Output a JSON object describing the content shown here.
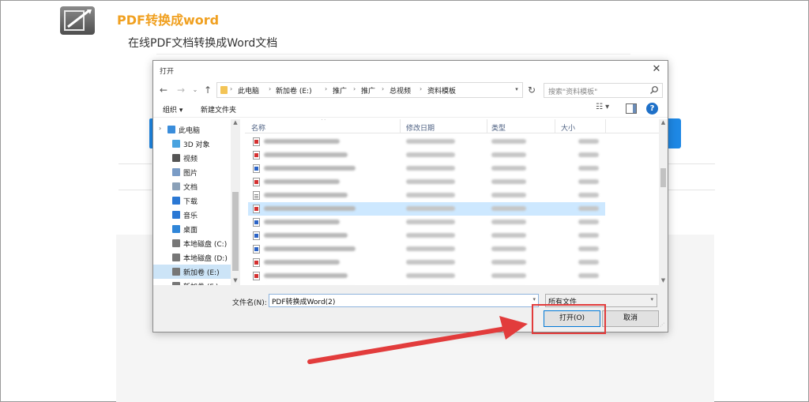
{
  "page": {
    "title": "PDF转换成word",
    "subtitle": "在线PDF文档转换成Word文档"
  },
  "dialog": {
    "title": "打开",
    "close_glyph": "✕",
    "nav": {
      "back": "←",
      "forward": "→",
      "recent": "⌄",
      "up": "↑",
      "refresh": "↻"
    },
    "breadcrumbs": [
      "此电脑",
      "新加卷 (E:)",
      "推广",
      "推广",
      "总视频",
      "资料模板"
    ],
    "crumb_separator": "›",
    "search_placeholder": "搜索\"资料模板\"",
    "toolbar": {
      "organize": "组织 ▾",
      "new_folder": "新建文件夹",
      "view_glyph": "☷ ▾",
      "help_glyph": "?"
    },
    "sidebar": {
      "items": [
        {
          "label": "此电脑",
          "icon": "computer-icon",
          "root": true,
          "caret": "›"
        },
        {
          "label": "3D 对象",
          "icon": "3d-objects-icon"
        },
        {
          "label": "视频",
          "icon": "video-icon"
        },
        {
          "label": "图片",
          "icon": "pictures-icon"
        },
        {
          "label": "文档",
          "icon": "documents-icon"
        },
        {
          "label": "下载",
          "icon": "download-icon"
        },
        {
          "label": "音乐",
          "icon": "music-icon"
        },
        {
          "label": "桌面",
          "icon": "desktop-icon"
        },
        {
          "label": "本地磁盘 (C:)",
          "icon": "drive-c-icon"
        },
        {
          "label": "本地磁盘 (D:)",
          "icon": "drive-d-icon"
        },
        {
          "label": "新加卷 (E:)",
          "icon": "drive-e-icon",
          "selected": true
        },
        {
          "label": "新加卷 (F:)",
          "icon": "drive-f-icon"
        }
      ]
    },
    "columns": {
      "name": "名称",
      "modified": "修改日期",
      "type": "类型",
      "size": "大小"
    },
    "files": [
      {
        "icon": "pdf",
        "selected": false
      },
      {
        "icon": "pdf",
        "selected": false
      },
      {
        "icon": "doc",
        "selected": false
      },
      {
        "icon": "pdf",
        "selected": false
      },
      {
        "icon": "txt",
        "selected": false
      },
      {
        "icon": "pdf",
        "selected": true
      },
      {
        "icon": "doc",
        "selected": false
      },
      {
        "icon": "doc",
        "selected": false
      },
      {
        "icon": "doc",
        "selected": false
      },
      {
        "icon": "pdf",
        "selected": false
      },
      {
        "icon": "pdf",
        "selected": false
      },
      {
        "icon": "doc",
        "selected": false
      }
    ],
    "filename_label": "文件名(N):",
    "filename_value": "PDF转换成Word(2)",
    "filetype_value": "所有文件",
    "open_button": "打开(O)",
    "cancel_button": "取消"
  },
  "colors": {
    "brand_orange": "#f0a020",
    "accent_blue": "#1e88e5",
    "annotation_red": "#e23c3c",
    "selection_blue": "#cde8ff"
  }
}
